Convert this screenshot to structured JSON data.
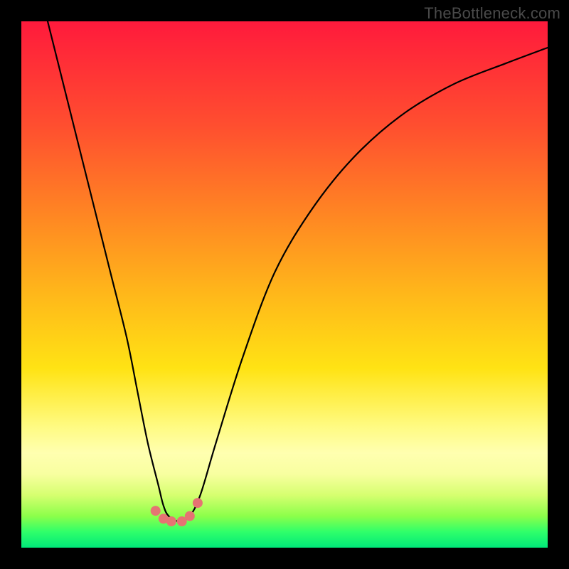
{
  "watermark": "TheBottleneck.com",
  "chart_data": {
    "type": "line",
    "title": "",
    "xlabel": "",
    "ylabel": "",
    "xlim": [
      0,
      100
    ],
    "ylim": [
      0,
      100
    ],
    "grid": false,
    "legend": false,
    "background_gradient": {
      "direction": "vertical",
      "stops": [
        {
          "pos": 0.0,
          "color": "#ff1a3c"
        },
        {
          "pos": 0.2,
          "color": "#ff4f2f"
        },
        {
          "pos": 0.52,
          "color": "#ffb81a"
        },
        {
          "pos": 0.77,
          "color": "#fffb82"
        },
        {
          "pos": 0.9,
          "color": "#d6ff70"
        },
        {
          "pos": 1.0,
          "color": "#00e879"
        }
      ]
    },
    "series": [
      {
        "name": "bottleneck-curve",
        "color": "#000000",
        "x": [
          5,
          8,
          11,
          14,
          17,
          20,
          22,
          24,
          26,
          27,
          28,
          30,
          32,
          34,
          37,
          42,
          48,
          55,
          63,
          72,
          82,
          92,
          100
        ],
        "y": [
          100,
          88,
          76,
          64,
          52,
          40,
          30,
          20,
          12,
          8,
          6,
          5,
          6,
          10,
          20,
          36,
          52,
          64,
          74,
          82,
          88,
          92,
          95
        ]
      }
    ],
    "markers": {
      "name": "trough-markers",
      "color": "#e57373",
      "x": [
        25.5,
        27.0,
        28.5,
        30.5,
        32.0,
        33.5
      ],
      "y": [
        7.0,
        5.5,
        5.0,
        5.0,
        6.0,
        8.5
      ]
    }
  }
}
